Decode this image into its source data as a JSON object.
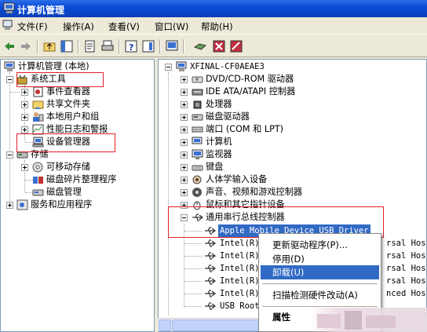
{
  "window": {
    "title": "计算机管理"
  },
  "menu": [
    "文件(F)",
    "操作(A)",
    "查看(V)",
    "窗口(W)",
    "帮助(H)"
  ],
  "left_tree": {
    "root": "计算机管理 (本地)",
    "system_tools": "系统工具",
    "system_children": [
      "事件查看器",
      "共享文件夹",
      "本地用户和组",
      "性能日志和警报",
      "设备管理器"
    ],
    "storage": "存储",
    "storage_children": [
      "可移动存储",
      "磁盘碎片整理程序",
      "磁盘管理"
    ],
    "services": "服务和应用程序"
  },
  "right_tree": {
    "computer": "XFINAL-CF0AEAE3",
    "categories": [
      "DVD/CD-ROM 驱动器",
      "IDE ATA/ATAPI 控制器",
      "处理器",
      "磁盘驱动器",
      "端口 (COM 和 LPT)",
      "计算机",
      "监视器",
      "键盘",
      "人体学输入设备",
      "声音、视频和游戏控制器",
      "鼠标和其它指针设备"
    ],
    "usb_category": "通用串行总线控制器",
    "usb_devices": [
      "Apple Mobile Device USB Driver",
      "Intel(R)",
      "Intel(R)",
      "Intel(R)",
      "Intel(R)",
      "Intel(R)",
      "USB Root"
    ],
    "usb_suffixes": [
      "rsal Host",
      "rsal Host",
      "rsal Host",
      "rsal Host",
      "nced Host"
    ]
  },
  "context_menu": {
    "update": "更新驱动程序(P)...",
    "disable": "停用(D)",
    "uninstall": "卸载(U)",
    "scan": "扫描检测硬件改动(A)",
    "properties": "属性"
  },
  "colors": {
    "accent_red": "#e0202a",
    "selection": "#316ac5",
    "titlebar": "#0a4ad8"
  }
}
